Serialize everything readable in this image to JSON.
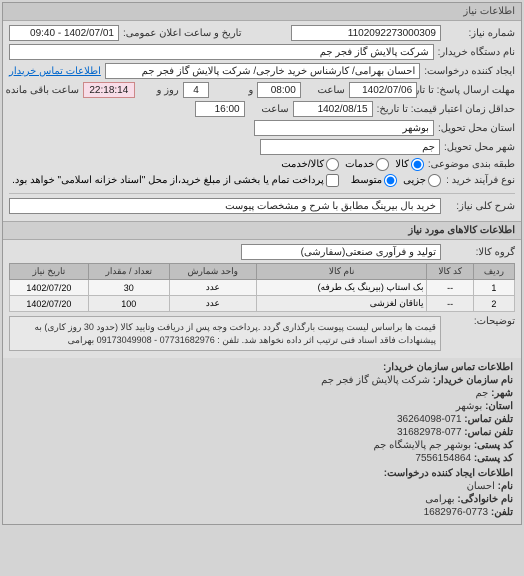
{
  "panel_title": "اطلاعات نیاز",
  "fields": {
    "number_label": "شماره نیاز:",
    "number": "1102092273000309",
    "announce_label": "تاریخ و ساعت اعلان عمومی:",
    "announce": "1402/07/01 - 09:40",
    "buyer_device_label": "نام دستگاه خریدار:",
    "buyer_device": "شرکت پالایش گاز فجر جم",
    "requester_label": "ایجاد کننده درخواست:",
    "requester": "احسان بهرامی/ کارشناس خرید خارجی/ شرکت پالایش گاز فجر جم",
    "contact_link": "اطلاعات تماس خریدار",
    "deadline_label": "مهلت ارسال پاسخ: تا تاریخ:",
    "deadline_date": "1402/07/06",
    "time_label": "ساعت",
    "deadline_time": "08:00",
    "and_label": "و",
    "days": "4",
    "day_label": "روز و",
    "remaining": "22:18:14",
    "remaining_label": "ساعت باقی مانده",
    "validity_label": "حداقل زمان اعتبار قیمت: تا تاریخ:",
    "validity_date": "1402/08/15",
    "validity_time": "16:00",
    "province_label": "استان محل تحویل:",
    "province": "بوشهر",
    "city_label": "شهر محل تحویل:",
    "city": "جم",
    "topic_label": "طبقه بندی موضوعی:",
    "topic_options": {
      "kala": "کالا",
      "khadamat": "خدمات",
      "both": "کالا/خدمت"
    },
    "purchase_label": "نوع فرآیند خرید :",
    "purchase_options": {
      "jozi": "جزیی",
      "motavaset": "متوسط"
    },
    "purchase_note": "پرداخت تمام یا بخشی از مبلغ خرید،از محل \"اسناد خزانه اسلامی\" خواهد بود.",
    "general_label": "شرح کلی نیاز:",
    "general": "خرید بال بیرینگ مطابق با شرح و مشخصات پیوست",
    "group_label": "گروه کالا:",
    "group": "تولید و فرآوری صنعتی(سفارشی)"
  },
  "items_title": "اطلاعات کالاهای مورد نیاز",
  "table": {
    "headers": {
      "row": "ردیف",
      "code": "کد کالا",
      "name": "نام کالا",
      "unit": "واحد شمارش",
      "qty": "تعداد / مقدار",
      "date": "تاریخ نیاز"
    },
    "rows": [
      {
        "row": "1",
        "code": "--",
        "name": "بک استاپ (بیرینگ یک طرفه)",
        "unit": "عدد",
        "qty": "30",
        "date": "1402/07/20"
      },
      {
        "row": "2",
        "code": "--",
        "name": "یاتاقان لغزشی",
        "unit": "عدد",
        "qty": "100",
        "date": "1402/07/20"
      }
    ]
  },
  "desc_label": "توضیحات:",
  "desc_text": "قیمت ها براساس لیست پیوست بارگذاری گردد .پرداخت وجه پس از دریافت وتایید کالا (حدود 30 روز کاری) به پیشنهادات فاقد اسناد فنی ترتیب اثر داده نخواهد شد. تلفن : 07731682976 - 09173049908 بهرامی",
  "contact": {
    "title": "اطلاعات تماس سازمان خریدار:",
    "org_label": "نام سازمان خریدار:",
    "org": "شرکت پالایش گاز فجر جم",
    "city_label": "شهر:",
    "city": "جم",
    "province_label": "استان:",
    "province": "بوشهر",
    "phone_label": "تلفن تماس:",
    "phone": "071-36264098",
    "fax_label": "تلفن نماس:",
    "fax": "077-31682978",
    "postal_label": "کد پستی:",
    "postal": "بوشهر جم پالایشگاه جم",
    "postal2_label": "کد پستی:",
    "postal2": "7556154864",
    "creator_title": "اطلاعات ایجاد کننده درخواست:",
    "name_label": "نام:",
    "name": "احسان",
    "lastname_label": "نام خانوادگی:",
    "lastname": "بهرامی",
    "tel_label": "تلفن:",
    "tel": "0773-1682976"
  }
}
